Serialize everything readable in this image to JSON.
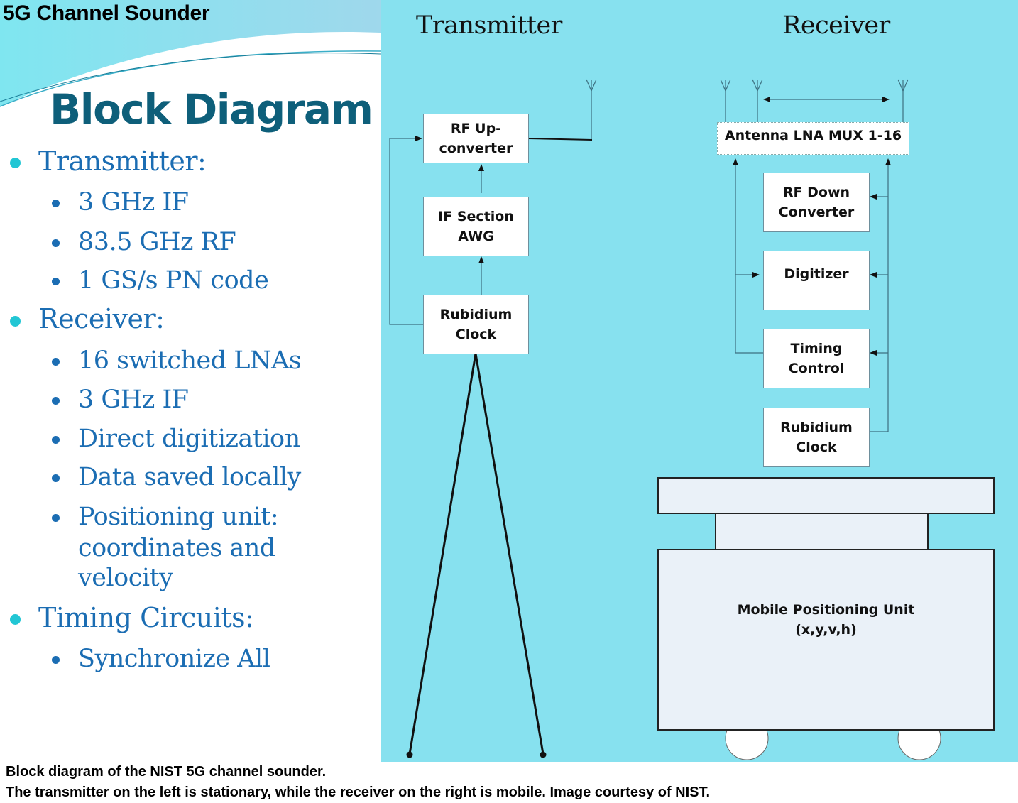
{
  "slide": {
    "header": "5G Channel Sounder",
    "heading": "Block Diagram",
    "bullets": [
      {
        "label": "Transmitter:",
        "children": [
          "3 GHz IF",
          "83.5 GHz RF",
          "1 GS/s PN code"
        ]
      },
      {
        "label": "Receiver:",
        "children": [
          "16 switched LNAs",
          "3 GHz IF",
          "Direct digitization",
          "Data saved locally",
          "Positioning unit: coordinates and velocity"
        ]
      },
      {
        "label": "Timing Circuits:",
        "children": [
          "Synchronize All"
        ]
      }
    ],
    "positioning_lines": [
      "Positioning unit:",
      "coordinates and",
      "velocity"
    ]
  },
  "diagram": {
    "transmitter": {
      "title": "Transmitter",
      "blocks": {
        "rf_upconverter": [
          "RF Up-",
          "converter"
        ],
        "if_section": [
          "IF Section",
          "AWG"
        ],
        "rubidium_clock": [
          "Rubidium",
          "Clock"
        ]
      }
    },
    "receiver": {
      "title": "Receiver",
      "blocks": {
        "antenna_mux": "Antenna LNA MUX 1-16",
        "rf_downconverter": [
          "RF Down",
          "Converter"
        ],
        "digitizer": "Digitizer",
        "timing_control": [
          "Timing",
          "Control"
        ],
        "rubidium_clock": [
          "Rubidium",
          "Clock"
        ]
      },
      "mobile_unit": [
        "Mobile Positioning Unit",
        "(x,y,v,h)"
      ]
    },
    "colors": {
      "background": "#87e1ef",
      "heading": "#0e5f7a",
      "bullet_text": "#1b6db3",
      "bullet_l1": "#22c6d4"
    }
  },
  "caption": {
    "line1": "Block diagram of the NIST 5G channel sounder.",
    "line2": "The transmitter on the left is stationary, while the receiver on the right is mobile. Image courtesy of NIST."
  }
}
